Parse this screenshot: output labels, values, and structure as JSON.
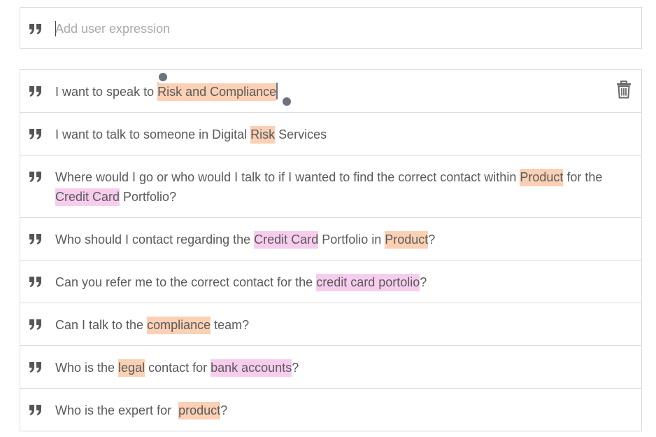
{
  "add_expression": {
    "placeholder": "Add user expression",
    "icon": "quote-icon"
  },
  "colors": {
    "entity_orange": "#fbd0b4",
    "entity_pink": "#f7cdee",
    "border": "#dcdcdc",
    "text": "#5a5a5a",
    "icon": "#555555"
  },
  "expressions": [
    {
      "segments": [
        {
          "text": "I want to speak to "
        },
        {
          "text": "Risk and Compliance",
          "entity": "orange",
          "selected": true
        }
      ]
    },
    {
      "segments": [
        {
          "text": "I want to talk to someone in Digital "
        },
        {
          "text": "Risk",
          "entity": "orange"
        },
        {
          "text": " Services"
        }
      ]
    },
    {
      "segments": [
        {
          "text": "Where would I go or who would I talk to if I wanted to find the correct contact within "
        },
        {
          "text": "Product",
          "entity": "orange"
        },
        {
          "text": " for the "
        },
        {
          "text": "Credit Card",
          "entity": "pink"
        },
        {
          "text": " Portfolio?"
        }
      ]
    },
    {
      "segments": [
        {
          "text": "Who should I contact regarding the "
        },
        {
          "text": "Credit Card",
          "entity": "pink"
        },
        {
          "text": " Portfolio in "
        },
        {
          "text": "Product",
          "entity": "orange"
        },
        {
          "text": "?"
        }
      ]
    },
    {
      "segments": [
        {
          "text": "Can you refer me to the correct contact for the "
        },
        {
          "text": "credit card portolio",
          "entity": "pink"
        },
        {
          "text": "?"
        }
      ]
    },
    {
      "segments": [
        {
          "text": "Can I talk to the "
        },
        {
          "text": "compliance",
          "entity": "orange"
        },
        {
          "text": " team?"
        }
      ]
    },
    {
      "segments": [
        {
          "text": "Who is the "
        },
        {
          "text": "legal",
          "entity": "orange"
        },
        {
          "text": " contact for "
        },
        {
          "text": "bank accounts",
          "entity": "pink"
        },
        {
          "text": "?"
        }
      ]
    },
    {
      "segments": [
        {
          "text": "Who is the expert for  "
        },
        {
          "text": "product",
          "entity": "orange"
        },
        {
          "text": "?"
        }
      ]
    }
  ]
}
